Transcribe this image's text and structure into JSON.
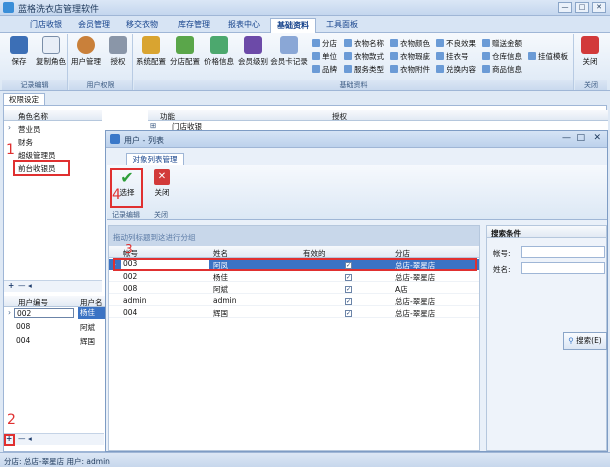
{
  "app": {
    "title": "蓝格洗衣店管理软件"
  },
  "window_controls": {
    "minimize": "—",
    "maximize": "□",
    "close": "✕"
  },
  "tabs": [
    "门店收银",
    "会员管理",
    "移交衣物",
    "库存管理",
    "报表中心",
    "基础资料",
    "工具面板"
  ],
  "ribbon": {
    "groups": {
      "records": "记录编辑",
      "user_perm": "用户权限",
      "basic": "基础资料",
      "close": "关闭"
    },
    "buttons": {
      "save": "保存",
      "copy_role": "复制角色",
      "user_manage": "用户管理",
      "authorize": "授权",
      "sys_config": "系统配置",
      "branch_config": "分店配置",
      "price_info": "价格信息",
      "member_level": "会员级别",
      "member_card_record": "会员卡记录",
      "close": "关闭"
    },
    "small": [
      "分店",
      "衣物名称",
      "衣物颜色",
      "不良效果",
      "赠送金额",
      "单位",
      "衣物款式",
      "衣物瑕疵",
      "挂衣号",
      "仓库信息",
      "挂值模板",
      "品牌",
      "服务类型",
      "衣物附件",
      "兑换内容",
      "商品信息"
    ]
  },
  "perm_tab": "权限设定",
  "roles": {
    "header": "角色名称",
    "items": [
      "营业员",
      "财务",
      "超级管理员",
      "前台收银员"
    ]
  },
  "func_grid": {
    "h_func": "功能",
    "h_auth": "授权",
    "first_row": "门店收银"
  },
  "users": {
    "h_num": "用户编号",
    "h_name": "用户名",
    "rows": [
      {
        "num": "002",
        "name": "杨佳"
      },
      {
        "num": "008",
        "name": "阿斌"
      },
      {
        "num": "004",
        "name": "辉国"
      }
    ]
  },
  "nav": {
    "add": "+",
    "remove": "—",
    "prev": "◂"
  },
  "dialog": {
    "title": "用户 - 列表",
    "tab": "对象列表管理",
    "select": "选择",
    "close": "关闭",
    "grp_records": "记录编辑",
    "grp_close": "关闭",
    "group_hint": "拖动列标题到这进行分组",
    "cols": [
      "帐号",
      "姓名",
      "有效的",
      "分店"
    ],
    "rows": [
      {
        "acct": "003",
        "name": "阿凤",
        "valid": "✓",
        "shop": "总店-翠星店"
      },
      {
        "acct": "002",
        "name": "杨佳",
        "valid": "✓",
        "shop": "总店-翠星店"
      },
      {
        "acct": "008",
        "name": "阿斌",
        "valid": "✓",
        "shop": "A店"
      },
      {
        "acct": "admin",
        "name": "admin",
        "valid": "✓",
        "shop": "总店-翠星店"
      },
      {
        "acct": "004",
        "name": "辉国",
        "valid": "✓",
        "shop": "总店-翠星店"
      }
    ],
    "search": {
      "title": "搜索条件",
      "acct": "帐号:",
      "name": "姓名:",
      "button": "搜索(E)"
    }
  },
  "markers": [
    "1",
    "2",
    "3",
    "4"
  ],
  "status": {
    "text": "分店: 总店-翠星店  用户: admin"
  },
  "colors": {
    "accent": "#3a78c9",
    "select": "#3b73c4",
    "marker": "#e03030"
  }
}
